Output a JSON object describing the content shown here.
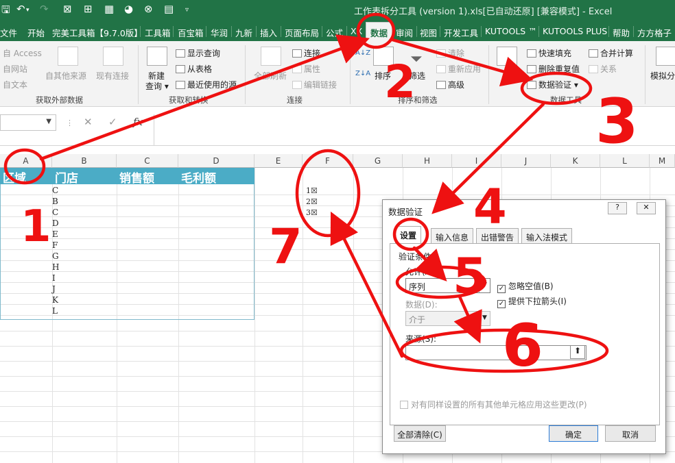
{
  "titlebar": {
    "title": "工作表拆分工具 (version 1).xls[已自动还原] [兼容模式] - Excel"
  },
  "menu": {
    "tabs": [
      "文件",
      "开始",
      "完美工具箱【9.7.0版】",
      "工具箱",
      "百宝箱",
      "华润",
      "九新",
      "插入",
      "页面布局",
      "公式",
      "XX",
      "数据",
      "审阅",
      "视图",
      "开发工具",
      "KUTOOLS ™",
      "KUTOOLS PLUS",
      "帮助",
      "方方格子"
    ],
    "active_tab": "数据"
  },
  "ribbon": {
    "ext_items": [
      "自 Access",
      "自网站",
      "自文本"
    ],
    "ext_other": "自其他来源",
    "ext_existing": "现有连接",
    "new_query": "新建\n查询",
    "transform_items": [
      "显示查询",
      "从表格",
      "最近使用的源"
    ],
    "refresh_all": "全部刷新",
    "conn_items": [
      "连接",
      "属性",
      "编辑链接"
    ],
    "sort": "排序",
    "filter": "筛选",
    "sort_items": [
      "清除",
      "重新应用",
      "高级"
    ],
    "tools_items": [
      "快速填充",
      "删除重复值",
      "数据验证"
    ],
    "tools_items2": [
      "合并计算",
      "关系"
    ],
    "whatif": "模拟分",
    "groups": [
      "获取外部数据",
      "获取和转换",
      "连接",
      "排序和筛选",
      "数据工具"
    ]
  },
  "formula_bar": {
    "namebox_value": "",
    "fx_label": "fx"
  },
  "sheet": {
    "columns": [
      "A",
      "B",
      "C",
      "D",
      "E",
      "F",
      "G",
      "H",
      "I",
      "J",
      "K",
      "L",
      "M"
    ],
    "headers": [
      "区域",
      "门店",
      "销售额",
      "毛利额"
    ],
    "stores": [
      "C",
      "B",
      "C",
      "D",
      "E",
      "F",
      "G",
      "H",
      "I",
      "J",
      "K",
      "L"
    ],
    "f_cells": [
      "1☒",
      "2☒",
      "3☒"
    ]
  },
  "dialog": {
    "title": "数据验证",
    "help": "?",
    "close": "✕",
    "tabs": [
      "设置",
      "输入信息",
      "出错警告",
      "输入法模式"
    ],
    "section": "验证条件",
    "allow_label": "允许(A):",
    "allow_value": "序列",
    "ignore_blank": "忽略空值(B)",
    "dropdown_arrow": "提供下拉箭头(I)",
    "data_label": "数据(D):",
    "data_value": "介于",
    "source_label": "来源(S):",
    "apply_all": "对有同样设置的所有其他单元格应用这些更改(P)",
    "clear_all": "全部清除(C)",
    "ok": "确定",
    "cancel": "取消"
  },
  "annotations": {
    "numbers": [
      "1",
      "2",
      "3",
      "4",
      "5",
      "6",
      "7"
    ],
    "color": "#ee1111"
  }
}
